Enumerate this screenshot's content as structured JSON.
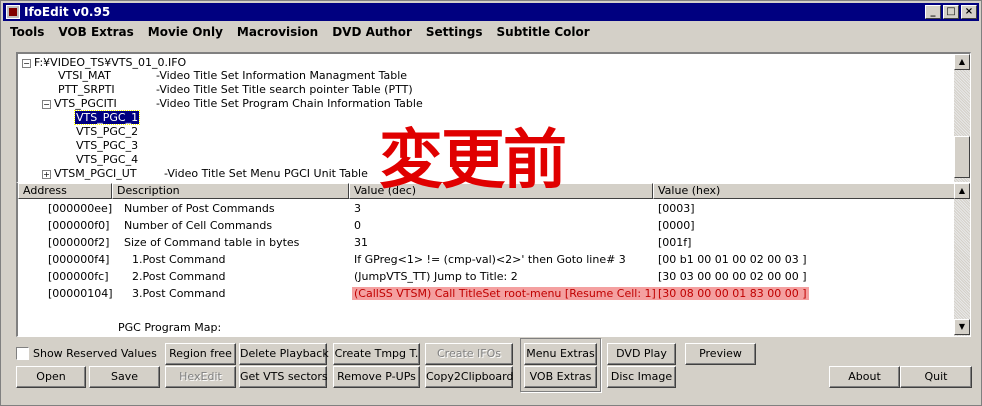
{
  "window": {
    "title": "IfoEdit v0.95",
    "minimize_icon": "minimize-icon",
    "maximize_icon": "maximize-icon",
    "close_icon": "close-icon"
  },
  "menu": [
    "Tools",
    "VOB Extras",
    "Movie Only",
    "Macrovision",
    "DVD Author",
    "Settings",
    "Subtitle Color"
  ],
  "tree": {
    "root": "F:¥VIDEO_TS¥VTS_01_0.IFO",
    "items": [
      {
        "label": "VTSI_MAT",
        "desc": "-Video Title Set Information Managment Table"
      },
      {
        "label": "PTT_SRPTI",
        "desc": "-Video Title Set Title search pointer Table (PTT)"
      },
      {
        "label": "VTS_PGCITI",
        "desc": "-Video Title Set Program Chain Information Table"
      },
      {
        "label": "VTS_PGC_1",
        "desc": ""
      },
      {
        "label": "VTS_PGC_2",
        "desc": ""
      },
      {
        "label": "VTS_PGC_3",
        "desc": ""
      },
      {
        "label": "VTS_PGC_4",
        "desc": ""
      },
      {
        "label": "VTSM_PGCI_UT",
        "desc": "-Video Title Set Menu PGCI Unit Table"
      }
    ]
  },
  "overlay_text": "変更前",
  "list": {
    "headers": [
      "Address",
      "Description",
      "Value (dec)",
      "Value (hex)"
    ],
    "rows": [
      {
        "address": "[000000ee]",
        "description": "Number of Post Commands",
        "dec": "3",
        "hex": "[0003]"
      },
      {
        "address": "[000000f0]",
        "description": "Number of Cell Commands",
        "dec": "0",
        "hex": "[0000]"
      },
      {
        "address": "[000000f2]",
        "description": "Size of Command table in bytes",
        "dec": "31",
        "hex": "[001f]"
      },
      {
        "address": "[000000f4]",
        "description": "1.Post Command",
        "dec": "If GPreg<1> != (cmp-val)<2>' then Goto line# 3",
        "hex": "[00 b1 00 01 00 02 00 03 ]"
      },
      {
        "address": "[000000fc]",
        "description": "2.Post Command",
        "dec": "(JumpVTS_TT) Jump to Title: 2",
        "hex": "[30 03 00 00 00 02 00 00 ]"
      },
      {
        "address": "[00000104]",
        "description": "3.Post Command",
        "dec": "(CallSS VTSM) Call TitleSet root-menu [Resume Cell: 1]",
        "hex": "[30 08 00 00 01 83 00 00 ]"
      }
    ],
    "footer_label": "PGC Program Map:"
  },
  "buttons": {
    "show_reserved": "Show Reserved Values",
    "region_free": "Region free",
    "delete_playback": "Delete Playback",
    "create_tmpg": "Create Tmpg T.",
    "create_ifos": "Create IFOs",
    "menu_extras": "Menu Extras",
    "dvd_play": "DVD Play",
    "preview": "Preview",
    "open": "Open",
    "save": "Save",
    "hexedit": "HexEdit",
    "get_vts": "Get VTS sectors",
    "remove_pups": "Remove P-UPs",
    "copy2clip": "Copy2Clipboard",
    "vob_extras": "VOB Extras",
    "disc_image": "Disc Image",
    "about": "About",
    "quit": "Quit"
  },
  "colors": {
    "titlebar": "#000080",
    "highlight": "#f4a0a0",
    "overlay": "#e00000"
  }
}
